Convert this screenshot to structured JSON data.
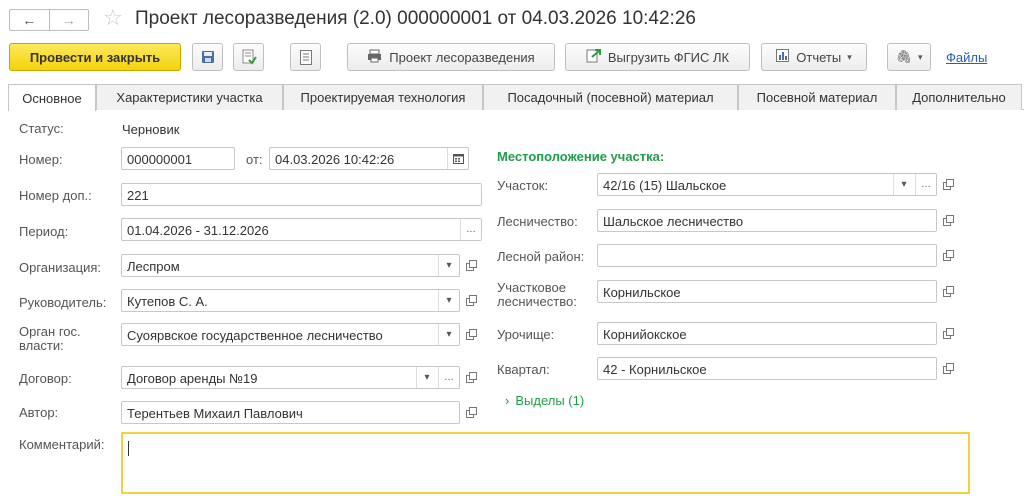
{
  "title": "Проект лесоразведения (2.0) 000000001 от 04.03.2026 10:42:26",
  "nav": {
    "back": "←",
    "forward": "→",
    "star": "☆"
  },
  "toolbar": {
    "post_close": "Провести и закрыть",
    "print_label": "Проект лесоразведения",
    "export_label": "Выгрузить ФГИС ЛК",
    "reports_label": "Отчеты",
    "files_label": "Файлы"
  },
  "tabs": [
    "Основное",
    "Характеристики участка",
    "Проектируемая технология",
    "Посадочный (посевной) материал",
    "Посевной материал",
    "Дополнительно"
  ],
  "form": {
    "status_label": "Статус:",
    "status_value": "Черновик",
    "number_label": "Номер:",
    "number_value": "000000001",
    "date_label": "от:",
    "date_value": "04.03.2026 10:42:26",
    "addnum_label": "Номер доп.:",
    "addnum_value": "221",
    "period_label": "Период:",
    "period_value": "01.04.2026 - 31.12.2026",
    "org_label": "Организация:",
    "org_value": "Леспром",
    "head_label": "Руководитель:",
    "head_value": "Кутепов С. А.",
    "gov_label": "Орган гос. власти:",
    "gov_value": "Суоярвское государственное лесничество",
    "contract_label": "Договор:",
    "contract_value": "Договор аренды №19",
    "author_label": "Автор:",
    "author_value": "Терентьев Михаил Павлович",
    "comment_label": "Комментарий:",
    "comment_value": ""
  },
  "location": {
    "title": "Местоположение участка:",
    "plot_label": "Участок:",
    "plot_value": "42/16 (15) Шальское",
    "forestry_label": "Лесничество:",
    "forestry_value": "Шальское лесничество",
    "district_label": "Лесной район:",
    "district_value": "",
    "subforestry_label": "Участковое лесничество:",
    "subforestry_value": "Корнильское",
    "tract_label": "Урочище:",
    "tract_value": "Корнийокское",
    "quarter_label": "Квартал:",
    "quarter_value": "42 - Корнильское",
    "allotments_label": "Выделы (1)"
  },
  "colors": {
    "accent_yellow": "#f4d20a",
    "section_green": "#1f9e4a",
    "link_blue": "#2b5db3"
  }
}
